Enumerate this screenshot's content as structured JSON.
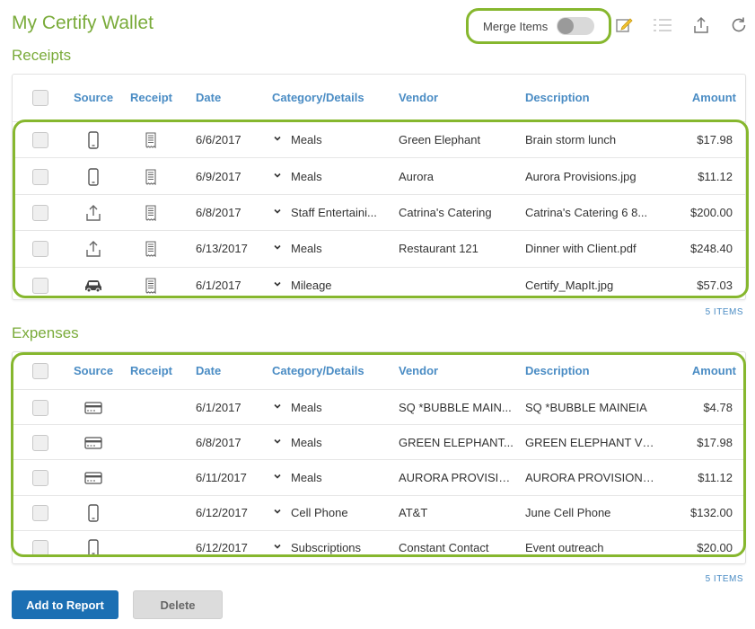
{
  "page_title": "My Certify Wallet",
  "toolbar": {
    "merge_label": "Merge Items",
    "merge_on": false,
    "icons": [
      "edit-icon",
      "list-icon",
      "upload-icon",
      "refresh-icon"
    ]
  },
  "receipts": {
    "title": "Receipts",
    "headers": {
      "source": "Source",
      "receipt": "Receipt",
      "date": "Date",
      "category": "Category/Details",
      "vendor": "Vendor",
      "description": "Description",
      "amount": "Amount"
    },
    "rows": [
      {
        "source": "phone",
        "receipt": true,
        "date": "6/6/2017",
        "category": "Meals",
        "vendor": "Green Elephant",
        "description": "Brain storm lunch",
        "amount": "$17.98"
      },
      {
        "source": "phone",
        "receipt": true,
        "date": "6/9/2017",
        "category": "Meals",
        "vendor": "Aurora",
        "description": "Aurora Provisions.jpg",
        "amount": "$11.12"
      },
      {
        "source": "upload",
        "receipt": true,
        "date": "6/8/2017",
        "category": "Staff Entertaini...",
        "vendor": "Catrina's Catering",
        "description": "Catrina's Catering 6 8...",
        "amount": "$200.00"
      },
      {
        "source": "upload",
        "receipt": true,
        "date": "6/13/2017",
        "category": "Meals",
        "vendor": "Restaurant 121",
        "description": "Dinner with Client.pdf",
        "amount": "$248.40"
      },
      {
        "source": "car",
        "receipt": true,
        "date": "6/1/2017",
        "category": "Mileage",
        "vendor": "",
        "description": "Certify_MapIt.jpg",
        "amount": "$57.03"
      }
    ],
    "count": "5 ITEMS"
  },
  "expenses": {
    "title": "Expenses",
    "headers": {
      "source": "Source",
      "receipt": "Receipt",
      "date": "Date",
      "category": "Category/Details",
      "vendor": "Vendor",
      "description": "Description",
      "amount": "Amount"
    },
    "rows": [
      {
        "source": "card",
        "receipt": false,
        "date": "6/1/2017",
        "category": "Meals",
        "vendor": "SQ *BUBBLE MAIN...",
        "description": "SQ *BUBBLE MAINEIA",
        "amount": "$4.78"
      },
      {
        "source": "card",
        "receipt": false,
        "date": "6/8/2017",
        "category": "Meals",
        "vendor": "GREEN ELEPHANT...",
        "description": "GREEN ELEPHANT VE...",
        "amount": "$17.98"
      },
      {
        "source": "card",
        "receipt": false,
        "date": "6/11/2017",
        "category": "Meals",
        "vendor": "AURORA PROVISIO...",
        "description": "AURORA PROVISIONS...",
        "amount": "$11.12"
      },
      {
        "source": "phone",
        "receipt": false,
        "date": "6/12/2017",
        "category": "Cell Phone",
        "vendor": "AT&T",
        "description": "June Cell Phone",
        "amount": "$132.00"
      },
      {
        "source": "phone",
        "receipt": false,
        "date": "6/12/2017",
        "category": "Subscriptions",
        "vendor": "Constant Contact",
        "description": "Event outreach",
        "amount": "$20.00"
      }
    ],
    "count": "5 ITEMS"
  },
  "actions": {
    "add_label": "Add to Report",
    "delete_label": "Delete"
  },
  "colors": {
    "accent_green": "#7aab3a",
    "highlight_green": "#86b72e",
    "header_blue": "#4a8cc4",
    "primary_button": "#1b6fb3"
  }
}
